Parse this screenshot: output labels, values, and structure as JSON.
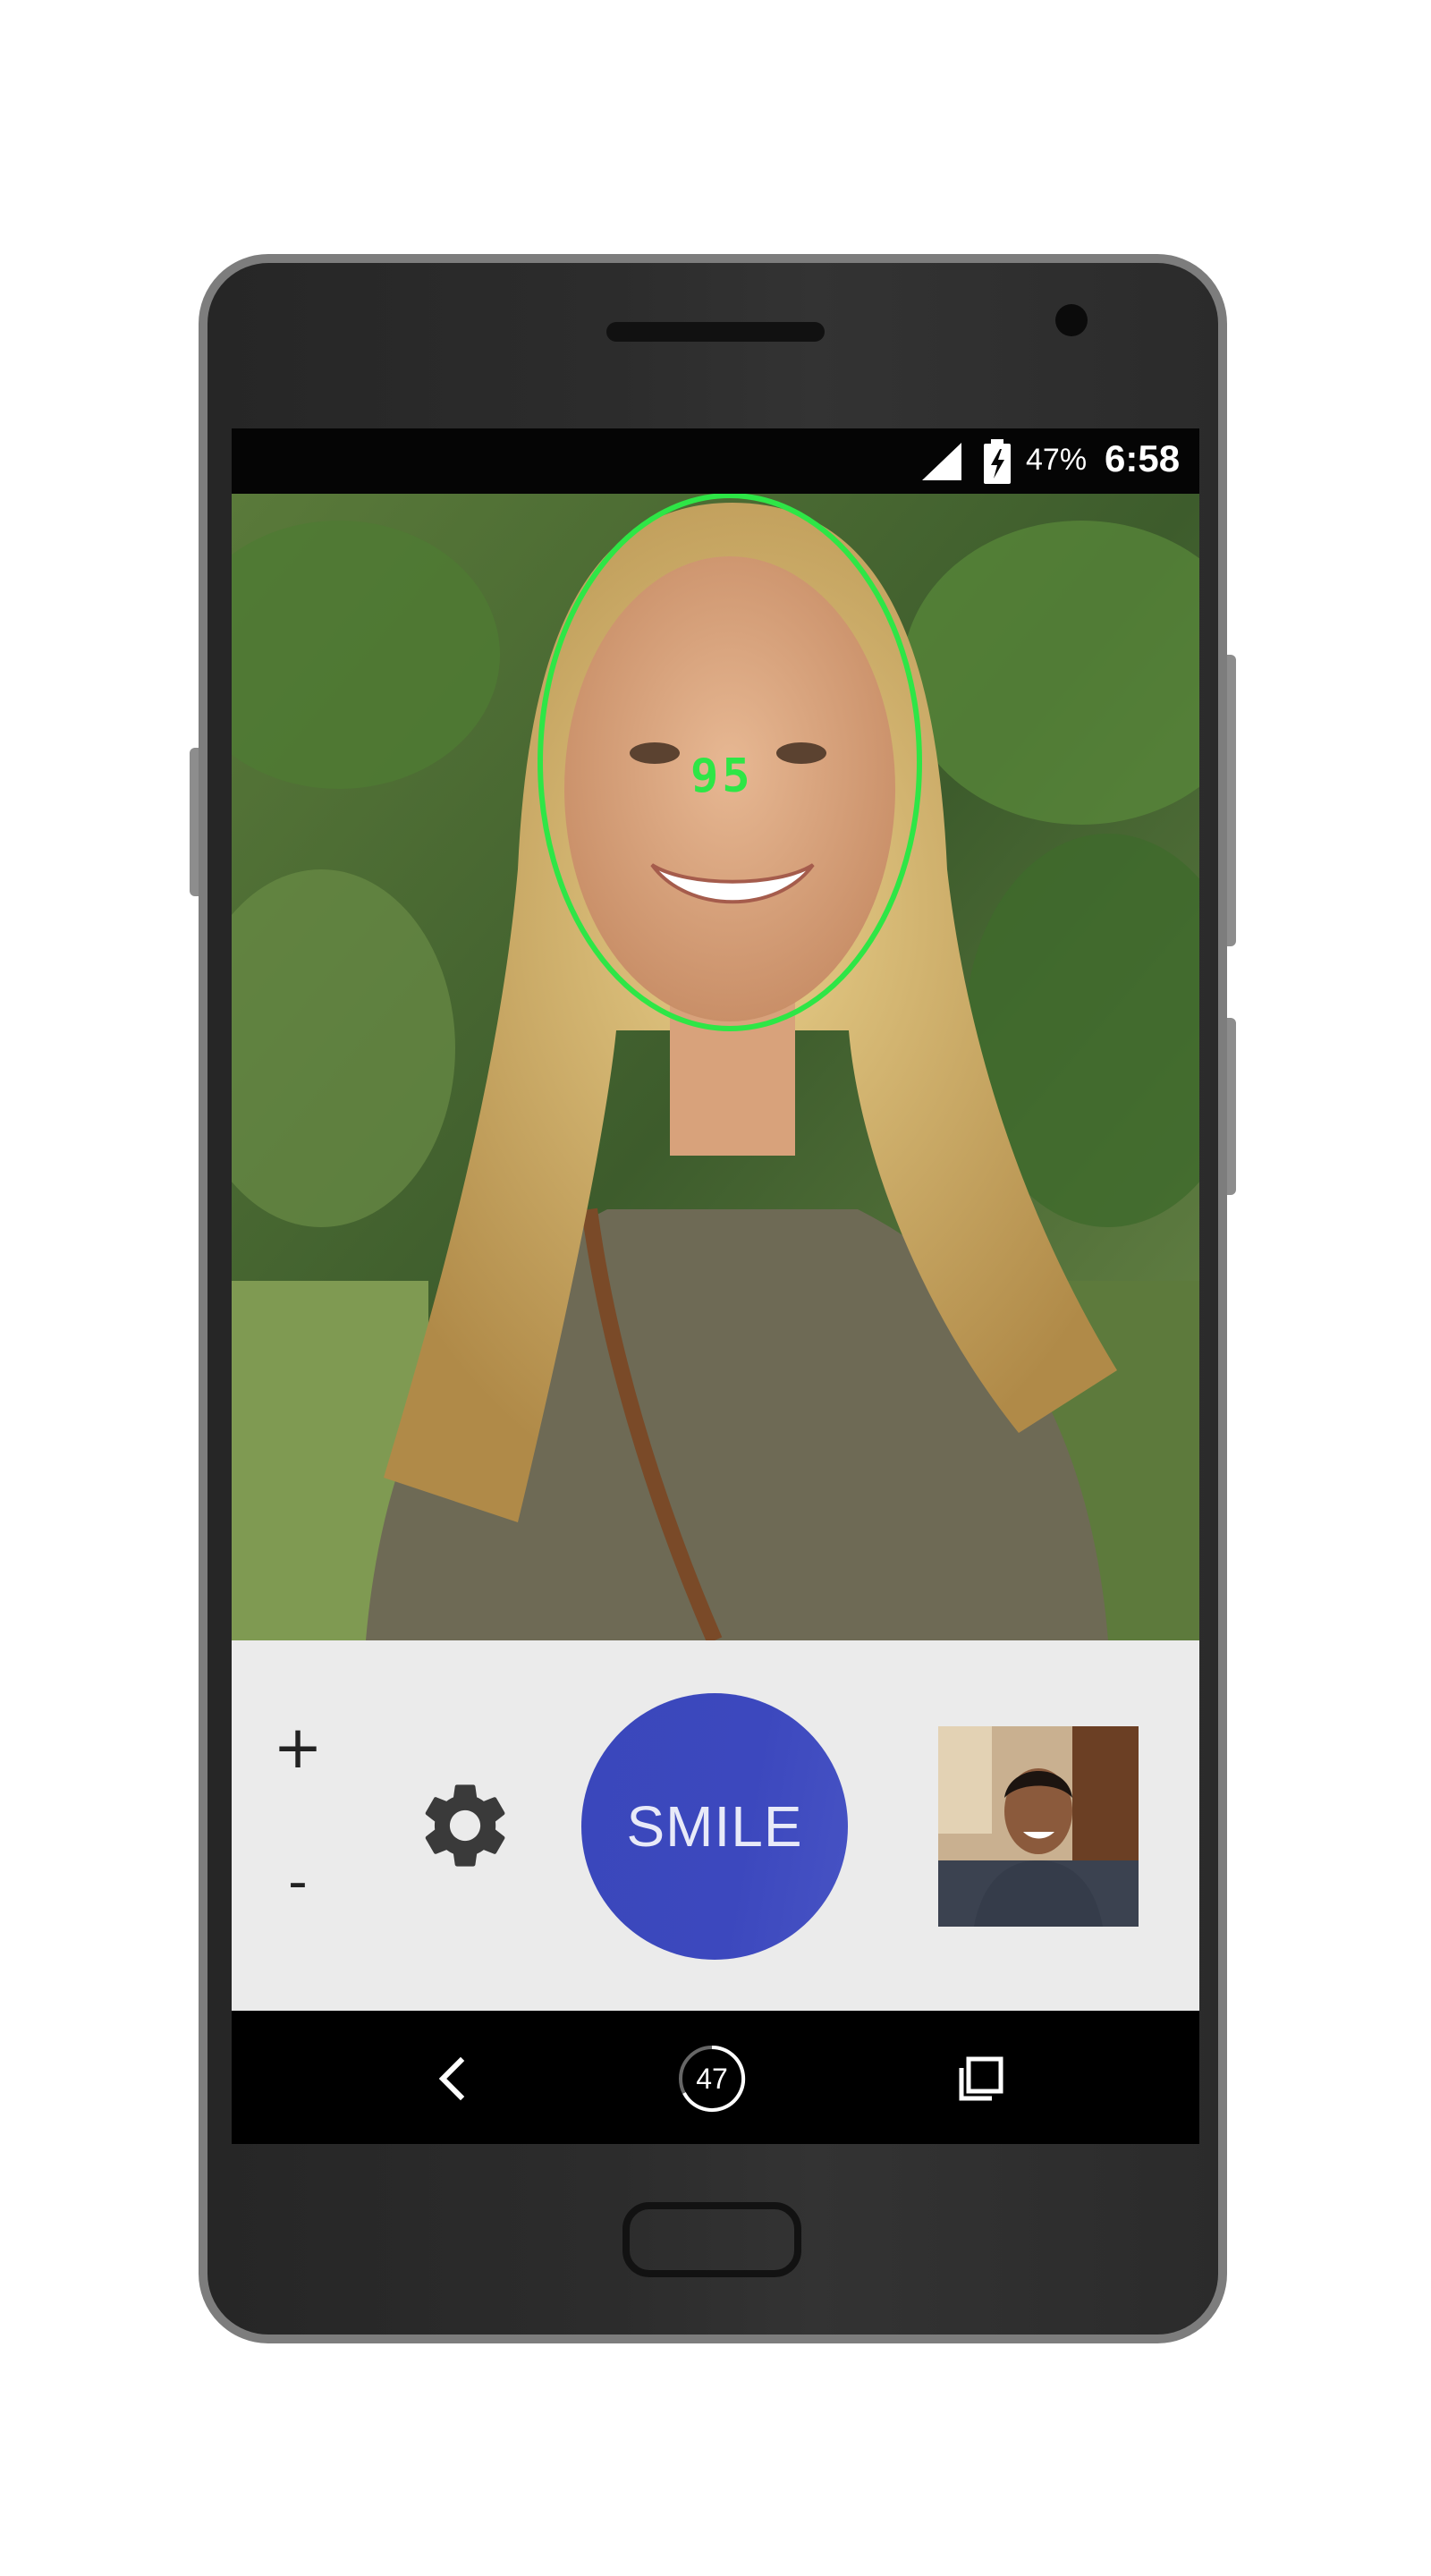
{
  "status_bar": {
    "battery_percent": "47%",
    "time": "6:58",
    "icons": [
      "signal-icon",
      "battery-charging-icon"
    ]
  },
  "preview": {
    "face_score": "95",
    "face_box_color": "#2ee646"
  },
  "controls": {
    "zoom_in_label": "+",
    "zoom_out_label": "-",
    "settings_icon": "gear-icon",
    "capture_label": "SMILE",
    "capture_color": "#3c48be"
  },
  "nav_bar": {
    "back_icon": "back-icon",
    "home_label": "47",
    "recents_icon": "recents-icon"
  }
}
